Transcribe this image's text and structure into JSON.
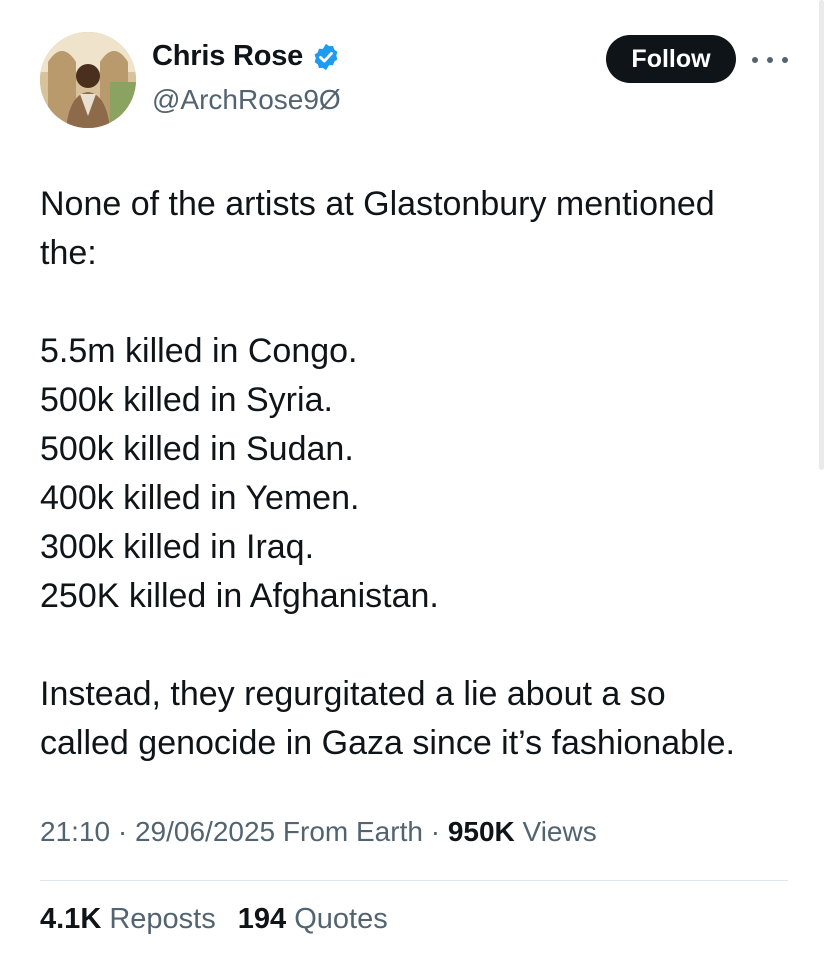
{
  "user": {
    "display_name": "Chris Rose",
    "handle": "@ArchRose9Ø",
    "verified_icon": "verified-badge-icon",
    "verified_color": "#1d9bf0"
  },
  "follow_label": "Follow",
  "more_icon": "more-options-icon",
  "tweet": {
    "intro_line1": "None of the artists at Glastonbury mentioned",
    "intro_line2": "the:",
    "list": [
      "5.5m killed in Congo.",
      "500k killed in Syria.",
      "500k killed in Sudan.",
      "400k killed in Yemen.",
      "300k killed in Iraq.",
      "250K killed in Afghanistan."
    ],
    "closing_line1": "Instead, they regurgitated a lie about a so",
    "closing_line2": "called genocide in Gaza since it’s fashionable."
  },
  "meta": {
    "time": "21:10",
    "date": "29/06/2025",
    "source": "From Earth",
    "views_count": "950K",
    "views_label": "Views",
    "separator": "·"
  },
  "stats": {
    "reposts_count": "4.1K",
    "reposts_label": "Reposts",
    "quotes_count": "194",
    "quotes_label": "Quotes"
  },
  "colors": {
    "text": "#0f1419",
    "secondary": "#536471",
    "follow_bg": "#0f1419",
    "divider": "#e1e6ea"
  }
}
